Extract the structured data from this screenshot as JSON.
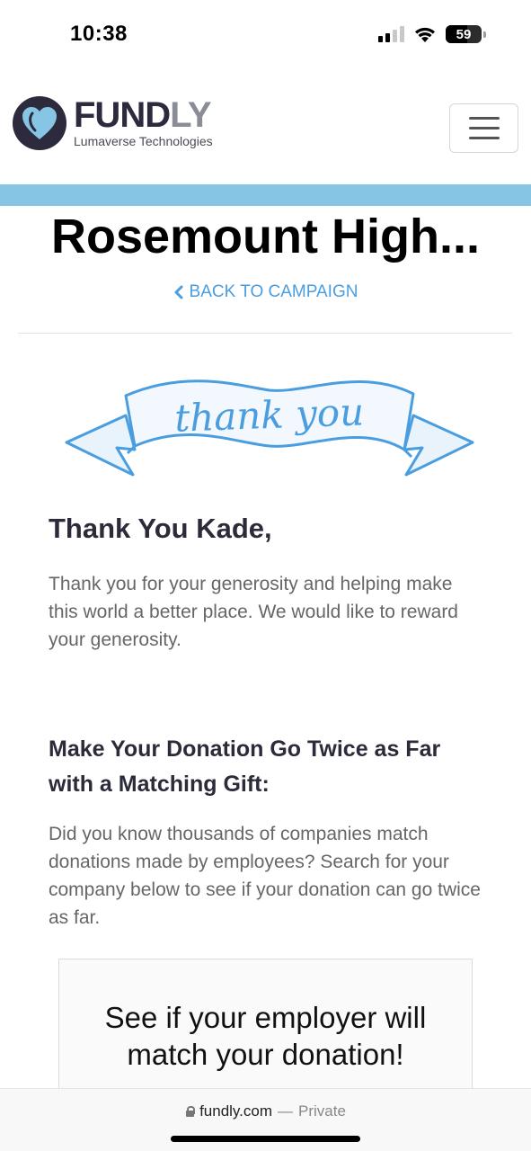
{
  "status_bar": {
    "time": "10:38",
    "battery_level": "59",
    "battery_fraction": 0.59,
    "signal_bars_active": 2,
    "signal_bars_total": 4
  },
  "header": {
    "logo_word_main": "FUND",
    "logo_word_accent": "LY",
    "logo_subtitle": "Lumaverse Technologies",
    "menu_icon": "hamburger-icon"
  },
  "campaign": {
    "title": "Rosemount High...",
    "back_label": "BACK TO CAMPAIGN",
    "back_icon": "chevron-left-icon"
  },
  "banner": {
    "text": "thank you",
    "color": "#4a9ee0"
  },
  "thanks": {
    "heading": "Thank You Kade,",
    "body": "Thank you for your generosity and helping make this world a better place. We would like to reward your generosity."
  },
  "matching": {
    "heading": "Make Your Donation Go Twice as Far with a Matching Gift:",
    "body": "Did you know thousands of companies match donations made by employees? Search for your company below to see if your donation can go twice as far."
  },
  "widget": {
    "text": "See if your employer will match your donation!"
  },
  "browser": {
    "domain": "fundly.com",
    "separator": "—",
    "mode": "Private"
  },
  "colors": {
    "accent_bar": "#86c5e4",
    "link": "#4a9ee0",
    "brand_dark": "#2c2a3c"
  }
}
